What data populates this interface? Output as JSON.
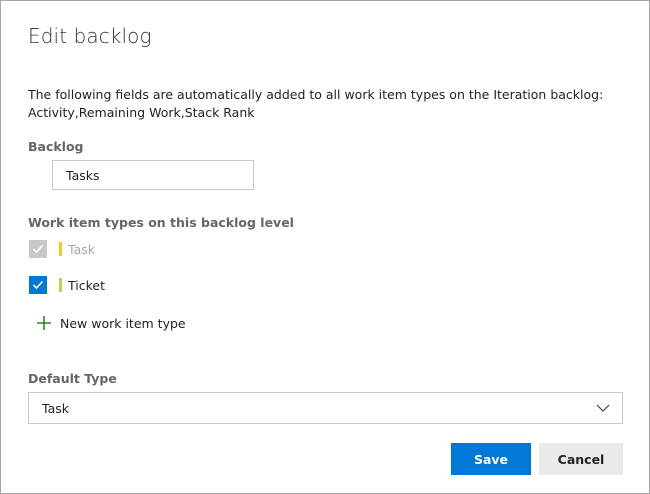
{
  "dialog": {
    "title": "Edit backlog",
    "info_line1": "The following fields are automatically added to all work item types on the Iteration backlog:",
    "info_line2": "Activity,Remaining Work,Stack Rank"
  },
  "backlog": {
    "label": "Backlog",
    "value": "Tasks"
  },
  "work_item_types": {
    "label": "Work item types on this backlog level",
    "items": [
      {
        "label": "Task",
        "checked": true,
        "disabled": true,
        "color": "#f2cb1d"
      },
      {
        "label": "Ticket",
        "checked": true,
        "disabled": false,
        "color": "#b4d84c"
      }
    ],
    "new_label": "New work item type"
  },
  "default_type": {
    "label": "Default Type",
    "selected": "Task"
  },
  "actions": {
    "save_label": "Save",
    "cancel_label": "Cancel"
  },
  "colors": {
    "accent": "#0078d7",
    "add_icon": "#107c10",
    "disabled": "#c8c8c8"
  },
  "icons": {
    "check": "checkmark-icon",
    "add": "plus-icon",
    "dropdown": "chevron-down-icon"
  }
}
